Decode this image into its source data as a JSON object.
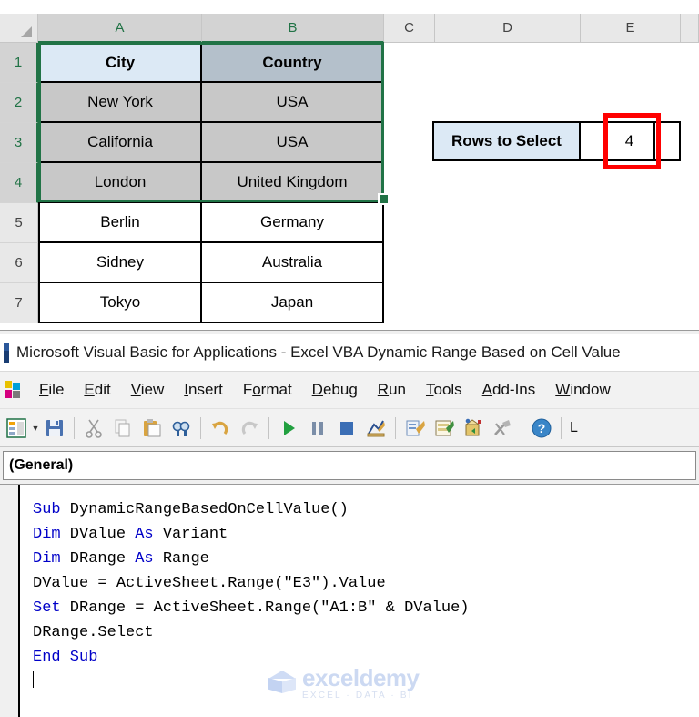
{
  "spreadsheet": {
    "column_headers": [
      "A",
      "B",
      "C",
      "D",
      "E"
    ],
    "row_headers": [
      "1",
      "2",
      "3",
      "4",
      "5",
      "6",
      "7"
    ],
    "selected_columns": [
      "A",
      "B"
    ],
    "selected_rows": [
      "1",
      "2",
      "3",
      "4"
    ],
    "selection_range": "A1:B4",
    "table": {
      "headers": [
        "City",
        "Country"
      ],
      "rows": [
        [
          "New York",
          "USA"
        ],
        [
          "California",
          "USA"
        ],
        [
          "London",
          "United Kingdom"
        ],
        [
          "Berlin",
          "Germany"
        ],
        [
          "Sidney",
          "Australia"
        ],
        [
          "Tokyo",
          "Japan"
        ]
      ]
    },
    "callout": {
      "label": "Rows to Select",
      "value": "4"
    },
    "colors": {
      "selection_border": "#217346",
      "highlight_box": "#ff0000",
      "header_fill": "#dce9f5",
      "selected_cell_fill": "#c8c8c8"
    }
  },
  "vba": {
    "title": "Microsoft Visual Basic for Applications - Excel VBA Dynamic Range Based on Cell Value",
    "menu": [
      {
        "label": "File",
        "accel": "F",
        "rest": "ile"
      },
      {
        "label": "Edit",
        "accel": "E",
        "rest": "dit"
      },
      {
        "label": "View",
        "accel": "V",
        "rest": "iew"
      },
      {
        "label": "Insert",
        "accel": "I",
        "rest": "nsert"
      },
      {
        "label": "Format",
        "accel": "o",
        "pre": "F",
        "rest": "rmat"
      },
      {
        "label": "Debug",
        "accel": "D",
        "rest": "ebug"
      },
      {
        "label": "Run",
        "accel": "R",
        "rest": "un"
      },
      {
        "label": "Tools",
        "accel": "T",
        "rest": "ools"
      },
      {
        "label": "Add-Ins",
        "accel": "A",
        "rest": "dd-Ins"
      },
      {
        "label": "Window",
        "accel": "W",
        "rest": "indow"
      }
    ],
    "toolbar_icons": [
      "view-microsoft-excel-icon",
      "dropdown-caret-icon",
      "save-icon",
      "cut-icon",
      "copy-icon",
      "paste-icon",
      "find-icon",
      "undo-icon",
      "redo-icon",
      "run-sub-icon",
      "break-icon",
      "reset-icon",
      "design-mode-icon",
      "project-explorer-icon",
      "properties-window-icon",
      "object-browser-icon",
      "toolbox-icon",
      "help-icon"
    ],
    "toolbar_status": "L",
    "object_combo": "(General)",
    "code_lines": [
      {
        "segments": [
          {
            "t": "Sub",
            "kw": true
          },
          {
            "t": " DynamicRangeBasedOnCellValue()",
            "kw": false
          }
        ]
      },
      {
        "segments": [
          {
            "t": "Dim",
            "kw": true
          },
          {
            "t": " DValue ",
            "kw": false
          },
          {
            "t": "As",
            "kw": true
          },
          {
            "t": " Variant",
            "kw": false
          }
        ]
      },
      {
        "segments": [
          {
            "t": "Dim",
            "kw": true
          },
          {
            "t": " DRange ",
            "kw": false
          },
          {
            "t": "As",
            "kw": true
          },
          {
            "t": " Range",
            "kw": false
          }
        ]
      },
      {
        "segments": [
          {
            "t": "DValue = ActiveSheet.Range(\"E3\").Value",
            "kw": false
          }
        ]
      },
      {
        "segments": [
          {
            "t": "Set",
            "kw": true
          },
          {
            "t": " DRange = ActiveSheet.Range(\"A1:B\" & DValue)",
            "kw": false
          }
        ]
      },
      {
        "segments": [
          {
            "t": "DRange.Select",
            "kw": false
          }
        ]
      },
      {
        "segments": [
          {
            "t": "End Sub",
            "kw": true
          }
        ]
      }
    ]
  },
  "watermark": {
    "name": "exceldemy",
    "tagline": "EXCEL · DATA · BI"
  }
}
